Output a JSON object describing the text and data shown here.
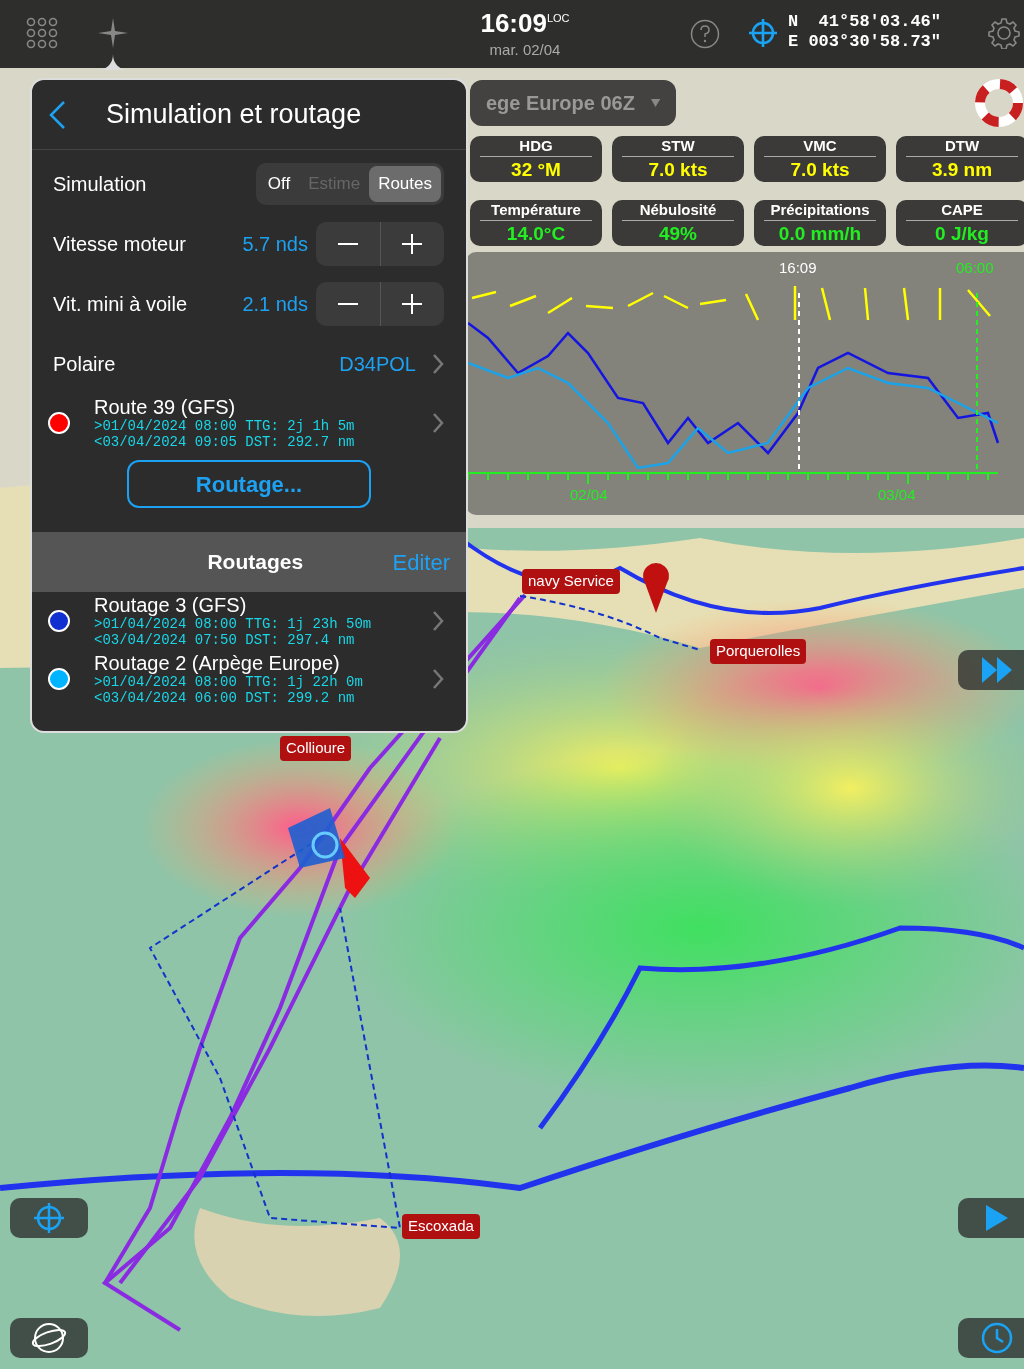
{
  "top_bar": {
    "time": "16:09",
    "time_suffix": "LOC",
    "date": "mar. 02/04",
    "lat_hemi": "N",
    "lat": "41°58'03.46\"",
    "lon_hemi": "E",
    "lon": "003°30'58.73\""
  },
  "grib_dropdown": {
    "value": "ege Europe 06Z"
  },
  "instruments": [
    {
      "label": "HDG",
      "value": "32 °M",
      "color": "#ffff00"
    },
    {
      "label": "STW",
      "value": "7.0 kts",
      "color": "#ffff00"
    },
    {
      "label": "VMC",
      "value": "7.0 kts",
      "color": "#ffff00"
    },
    {
      "label": "DTW",
      "value": "3.9 nm",
      "color": "#ffff00"
    },
    {
      "label": "Température",
      "value": "14.0°C",
      "color": "#22ee22"
    },
    {
      "label": "Nébulosité",
      "value": "49%",
      "color": "#22ee22"
    },
    {
      "label": "Précipitations",
      "value": "0.0 mm/h",
      "color": "#22ee22"
    },
    {
      "label": "CAPE",
      "value": "0 J/kg",
      "color": "#22ee22"
    }
  ],
  "meteogram": {
    "now_label": "16:09",
    "end_label": "06:00",
    "dates": [
      "02/04",
      "03/04"
    ]
  },
  "panel": {
    "title": "Simulation et routage",
    "simulation": {
      "label": "Simulation",
      "options": [
        {
          "label": "Off",
          "selected": false,
          "disabled": false
        },
        {
          "label": "Estime",
          "selected": false,
          "disabled": true
        },
        {
          "label": "Routes",
          "selected": true,
          "disabled": false
        }
      ]
    },
    "steppers": [
      {
        "label": "Vitesse moteur",
        "value": "5.7 nds"
      },
      {
        "label": "Vit. mini à voile",
        "value": "2.1 nds"
      }
    ],
    "polar": {
      "label": "Polaire",
      "value": "D34POL"
    },
    "current_route": {
      "name": "Route 39 (GFS)",
      "color": "#ff0000",
      "line_1": ">01/04/2024 08:00 TTG: 2j 1h 5m",
      "line_2": "<03/04/2024 09:05 DST: 292.7 nm"
    },
    "routing_button": "Routage...",
    "section": {
      "title": "Routages",
      "action": "Editer"
    },
    "routings": [
      {
        "name": "Routage 3 (GFS)",
        "color": "#1030d0",
        "line_1": ">01/04/2024 08:00 TTG: 1j 23h 50m",
        "line_2": "<03/04/2024 07:50 DST: 297.4 nm"
      },
      {
        "name": "Routage 2 (Arpège Europe)",
        "color": "#00b4ff",
        "line_1": ">01/04/2024 08:00 TTG: 1j 22h 0m",
        "line_2": "<03/04/2024 06:00 DST: 299.2 nm"
      }
    ]
  },
  "map_labels": [
    {
      "text": "navy Service"
    },
    {
      "text": "Porquerolles"
    },
    {
      "text": "Collioure"
    },
    {
      "text": "Escoxada"
    }
  ]
}
